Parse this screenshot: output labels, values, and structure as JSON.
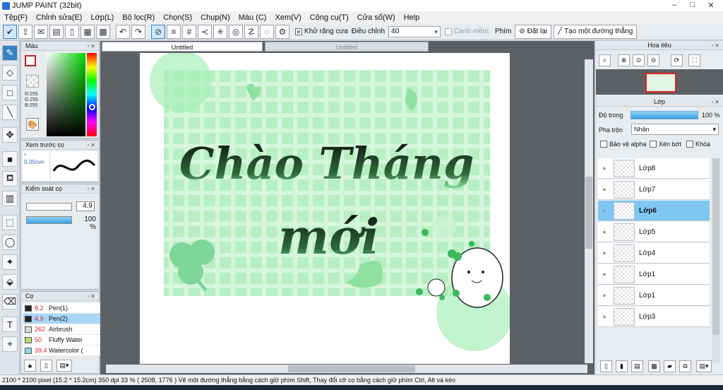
{
  "window": {
    "title": "JUMP PAINT (32bit)",
    "min": "–",
    "max": "□",
    "close": "✕"
  },
  "menu": [
    "Tệp(F)",
    "Chỉnh sửa(E)",
    "Lớp(L)",
    "Bộ lọc(R)",
    "Chọn(S)",
    "Chụp(N)",
    "Màu (C)",
    "Xem(V)",
    "Công cụ(T)",
    "Cửa sổ(W)",
    "Help"
  ],
  "toolbar": {
    "antialias_label": "Khử răng cưa",
    "adjust_label": "Điều chỉnh",
    "adjust_value": "40",
    "smooth_label": "Canh mềm",
    "key_label": "Phím",
    "reset_label": "Đặt lại",
    "line_label": "Tạo một đường thẳng"
  },
  "color_panel": {
    "title": "Màu",
    "r": "R:255",
    "g": "G:255",
    "b": "B:255",
    "fg": "#ffffff",
    "accent": "#c0222a"
  },
  "brush_preview": {
    "title": "Xem trước cọ",
    "size": "* 0.35mm"
  },
  "brush_control": {
    "title": "Kiểm soát cọ",
    "size": "4.9",
    "opacity": "100 %",
    "opacity_pct": 100
  },
  "brush_list": {
    "title": "Cọ",
    "items": [
      {
        "size": "8.2",
        "name": "Pen(1)",
        "color": "#222222",
        "sel": false
      },
      {
        "size": "4.9",
        "name": "Pen(2)",
        "color": "#222222",
        "sel": true
      },
      {
        "size": "262",
        "name": "Airbrush",
        "color": "#dddddd",
        "sel": false
      },
      {
        "size": "50",
        "name": "Fluffy Water",
        "color": "#b6e07c",
        "sel": false
      },
      {
        "size": "39.4",
        "name": "Watercolor (",
        "color": "#8fd6f0",
        "sel": false
      }
    ]
  },
  "tabs": [
    {
      "label": "Untitled",
      "active": true
    },
    {
      "label": "Untitled",
      "active": false
    }
  ],
  "artwork": {
    "line1": "Chào Tháng",
    "line2": "mới",
    "accent": "#32b84e"
  },
  "navigator": {
    "title": "Hoa tiêu"
  },
  "layers": {
    "title": "Lớp",
    "opacity_label": "Độ trong",
    "opacity": "100 %",
    "opacity_pct": 100,
    "blend_label": "Pha trộn",
    "blend_value": "Nhân",
    "protect_alpha": "Bảo vệ alpha",
    "clip": "Xén bớt",
    "lock": "Khóa",
    "items": [
      {
        "name": "Lớp8",
        "sel": false
      },
      {
        "name": "Lớp7",
        "sel": false
      },
      {
        "name": "Lớp6",
        "sel": true
      },
      {
        "name": "Lớp5",
        "sel": false
      },
      {
        "name": "Lớp4",
        "sel": false
      },
      {
        "name": "Lớp1",
        "sel": false
      },
      {
        "name": "Lớp1",
        "sel": false
      },
      {
        "name": "Lớp3",
        "sel": false
      }
    ]
  },
  "status": "2100 * 2100 pixel   (15.2 * 15.2cm)   350 dpi   33 %   ( 2508, 1776 )   Vẽ một đường thẳng bằng cách giữ phím Shift, Thay đổi cỡ cọ bằng cách giữ phím Ctrl, Alt và kéo"
}
